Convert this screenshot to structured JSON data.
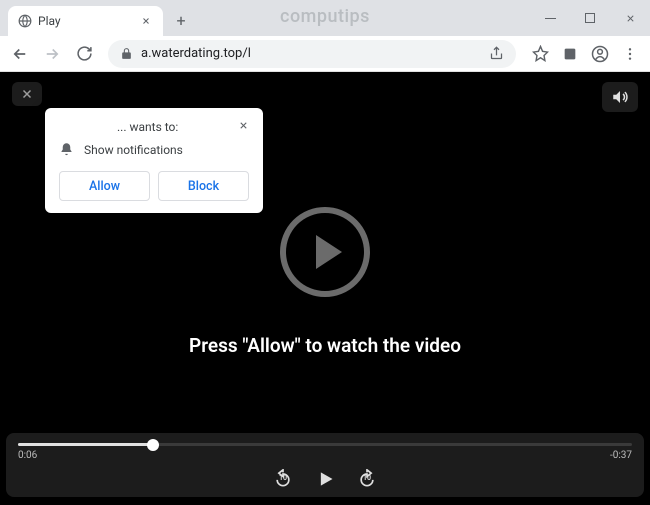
{
  "window": {
    "watermark": "computips"
  },
  "tab": {
    "title": "Play"
  },
  "omnibox": {
    "url": "a.waterdating.top/l"
  },
  "permission": {
    "title": "... wants to:",
    "line": "Show notifications",
    "allow": "Allow",
    "block": "Block"
  },
  "page": {
    "message": "Press \"Allow\" to watch the video"
  },
  "player": {
    "elapsed": "0:06",
    "remaining": "-0:37",
    "back_secs": "10",
    "fwd_secs": "10"
  }
}
